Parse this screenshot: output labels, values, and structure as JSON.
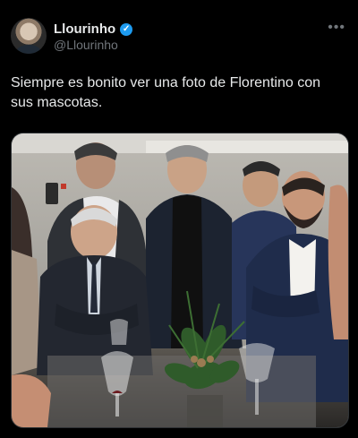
{
  "author": {
    "display_name": "Llourinho",
    "handle": "@Llourinho",
    "verified_badge": "✓"
  },
  "more_menu": "•••",
  "tweet": {
    "text": "Siempre es bonito ver una foto de Florentino con sus mascotas."
  },
  "colors": {
    "background": "#000000",
    "text": "#e7e9ea",
    "secondary_text": "#71767b",
    "verified": "#1d9bf0"
  },
  "icons": [
    "verified-badge-icon",
    "more-options-icon"
  ]
}
